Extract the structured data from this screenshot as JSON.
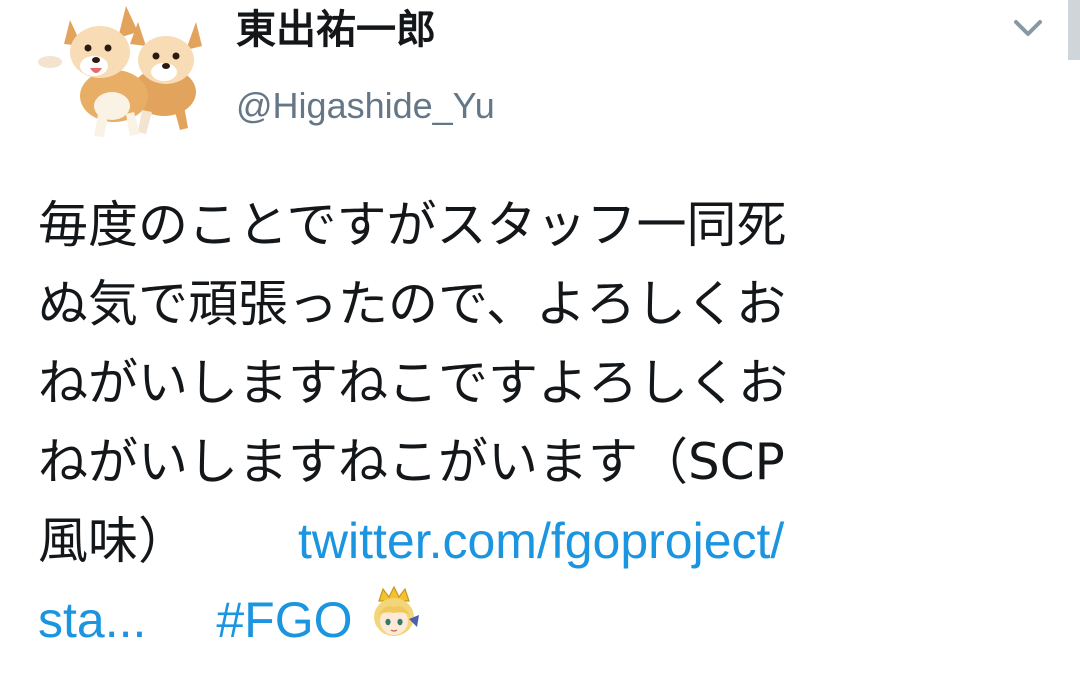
{
  "author": {
    "display_name": "東出祐一郎",
    "handle": "@Higashide_Yu"
  },
  "tweet": {
    "lines": {
      "l1": "毎度のことですがスタッフ一同死",
      "l2": "ぬ気で頑張ったので、よろしくお",
      "l3": "ねがいしますねこですよろしくお",
      "l4": "ねがいしますねこがいます（SCP",
      "l5_text": "風味）",
      "link": "twitter.com/fgoproject/",
      "link_cont": "sta...",
      "hashtag": "#FGO"
    }
  },
  "icons": {
    "caret": "chevron-down-icon",
    "avatar": "corgi-avatar",
    "emoji": "fgo-character-emoji"
  },
  "colors": {
    "link": "#1b95e0",
    "handle": "#657786",
    "text": "#14171a"
  }
}
